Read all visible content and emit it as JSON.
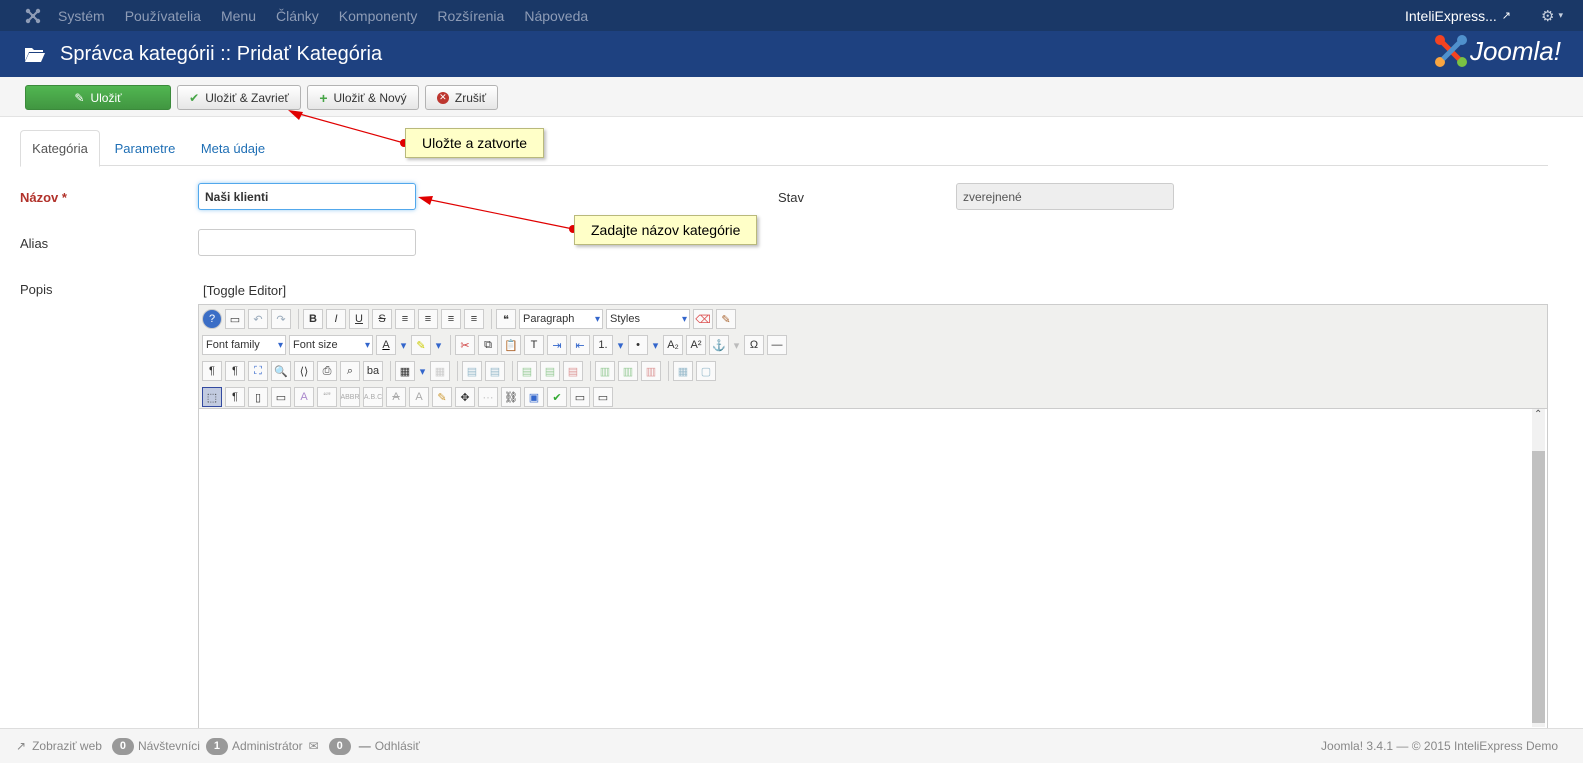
{
  "topnav": {
    "menu": [
      "Systém",
      "Používatelia",
      "Menu",
      "Články",
      "Komponenty",
      "Rozšírenia",
      "Nápoveda"
    ],
    "site_name": "InteliExpress...",
    "settings_icon": "gear-icon"
  },
  "header": {
    "title": "Správca kategórii :: Pridať Kategória",
    "brand": "Joomla!"
  },
  "toolbar": {
    "save": "Uložiť",
    "save_close": "Uložiť & Zavrieť",
    "save_new": "Uložiť & Nový",
    "cancel": "Zrušiť"
  },
  "tabs": [
    "Kategória",
    "Parametre",
    "Meta údaje"
  ],
  "form": {
    "title_label": "Názov *",
    "title_value": "Naši klienti",
    "alias_label": "Alias",
    "alias_value": "",
    "status_label": "Stav",
    "status_value": "zverejnené",
    "desc_label": "Popis",
    "toggle_editor": "[Toggle Editor]"
  },
  "editor": {
    "format_select": "Paragraph",
    "styles_select": "Styles",
    "font_family_select": "Font family",
    "font_size_select": "Font size"
  },
  "annotations": {
    "save_close_tip": "Uložte a zatvorte",
    "title_tip": "Zadajte názov kategórie"
  },
  "status": {
    "view_site": "Zobraziť web",
    "visitors_count": "0",
    "visitors": "Návštevníci",
    "admins_count": "1",
    "admins": "Administrátor",
    "messages_count": "0",
    "logout": "Odhlásiť",
    "version": "Joomla! 3.4.1 — © 2015 InteliExpress Demo"
  },
  "colors": {
    "nav_bg": "#1a3867",
    "header_bg": "#1e4180",
    "save_green": "#46a546",
    "required_red": "#b1312a",
    "annotation_arrow": "#e00000"
  }
}
